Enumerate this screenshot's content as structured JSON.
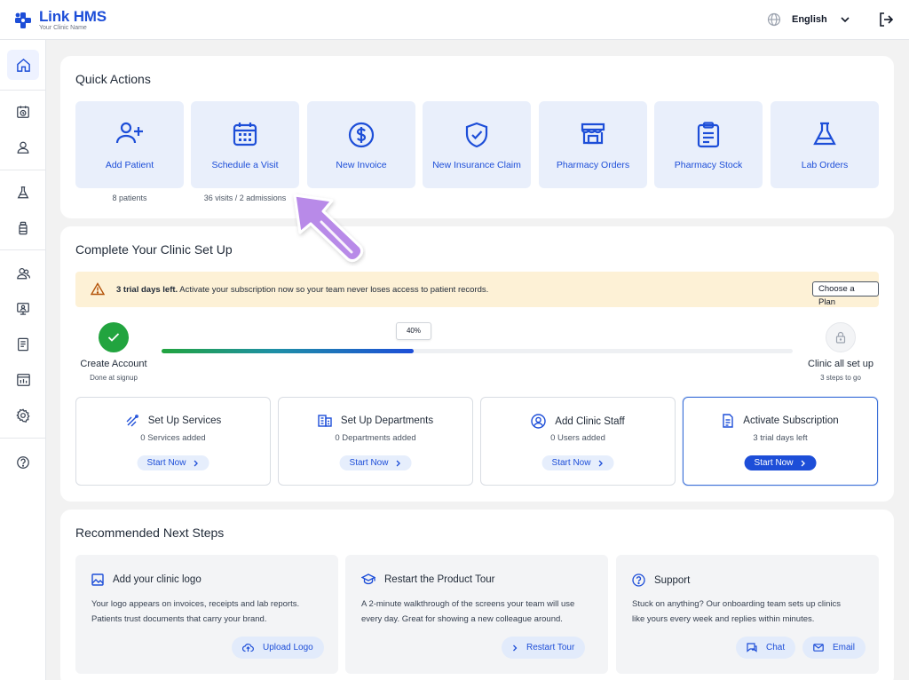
{
  "app": {
    "brand": "Link HMS",
    "brand_first": "Link",
    "brand_second": "HMS",
    "clinic_name": "Your Clinic Name"
  },
  "header": {
    "language": "English",
    "icons": [
      "globe-icon",
      "chevron-down-icon",
      "logout-icon"
    ]
  },
  "sidebar": {
    "items": [
      {
        "name": "home",
        "icon": "home-icon",
        "active": true
      },
      {
        "name": "appointments",
        "icon": "calendar-clock-icon"
      },
      {
        "name": "patients",
        "icon": "user-icon"
      },
      {
        "name": "lab",
        "icon": "flask-icon"
      },
      {
        "name": "pharmacy",
        "icon": "bottle-icon"
      },
      {
        "name": "staff",
        "icon": "users-icon"
      },
      {
        "name": "monitor",
        "icon": "monitor-icon"
      },
      {
        "name": "reports",
        "icon": "document-icon"
      },
      {
        "name": "analytics",
        "icon": "chart-icon"
      },
      {
        "name": "settings",
        "icon": "gear-icon"
      },
      {
        "name": "help",
        "icon": "help-icon"
      }
    ]
  },
  "quick_actions": {
    "title": "Quick Actions",
    "items": [
      {
        "label": "Add Patient",
        "icon": "user-plus-icon",
        "sub": "8 patients"
      },
      {
        "label": "Schedule a Visit",
        "icon": "calendar-icon",
        "sub": "36 visits / 2 admissions"
      },
      {
        "label": "New Invoice",
        "icon": "dollar-circle-icon"
      },
      {
        "label": "New Insurance Claim",
        "icon": "shield-check-icon"
      },
      {
        "label": "Pharmacy Orders",
        "icon": "store-icon"
      },
      {
        "label": "Pharmacy Stock",
        "icon": "clipboard-icon"
      },
      {
        "label": "Lab Orders",
        "icon": "flask-icon"
      }
    ]
  },
  "setup": {
    "title": "Complete Your Clinic Set Up",
    "banner": {
      "bold": "3 trial days left.",
      "text": " Activate your subscription now so your team never loses access to patient records.",
      "button": "Choose a Plan",
      "icon": "warning-icon"
    },
    "progress": {
      "percent": 40,
      "percent_label": "40%",
      "start_label": "Create Account",
      "start_sub": "Done at signup",
      "end_label": "Clinic all set up",
      "end_sub": "3 steps to go"
    },
    "cards": [
      {
        "title": "Set Up Services",
        "sub": "0 Services added",
        "button": "Start Now",
        "icon": "services-icon"
      },
      {
        "title": "Set Up Departments",
        "sub": "0 Departments added",
        "button": "Start Now",
        "icon": "building-icon"
      },
      {
        "title": "Add Clinic Staff",
        "sub": "0 Users added",
        "button": "Start Now",
        "icon": "user-circle-icon"
      },
      {
        "title": "Activate Subscription",
        "sub": "3 trial days left",
        "button": "Start Now",
        "icon": "receipt-icon",
        "highlighted": true
      }
    ]
  },
  "recommended": {
    "title": "Recommended Next Steps",
    "cards": [
      {
        "title": "Add your clinic logo",
        "line1": "Your logo appears on invoices, receipts and lab reports.",
        "line2": "Patients trust documents that carry your brand.",
        "buttons": [
          "Upload Logo"
        ],
        "icon": "image-icon"
      },
      {
        "title": "Restart the Product Tour",
        "line1": "A 2-minute walkthrough of the screens your team will use",
        "line2": "every day. Great for showing a new colleague around.",
        "buttons": [
          "Restart Tour"
        ],
        "icon": "graduation-cap-icon"
      },
      {
        "title": "Support",
        "line1": "Stuck on anything? Our onboarding team sets up clinics",
        "line2": "like yours every week and replies within minutes.",
        "buttons": [
          "Chat",
          "Email"
        ],
        "icon": "help-icon"
      }
    ]
  },
  "colors": {
    "accent": "#1d4ed8",
    "success": "#22a43f",
    "banner": "#fdf1d6",
    "card": "#e9effb",
    "cursor": "#b88ae8"
  }
}
